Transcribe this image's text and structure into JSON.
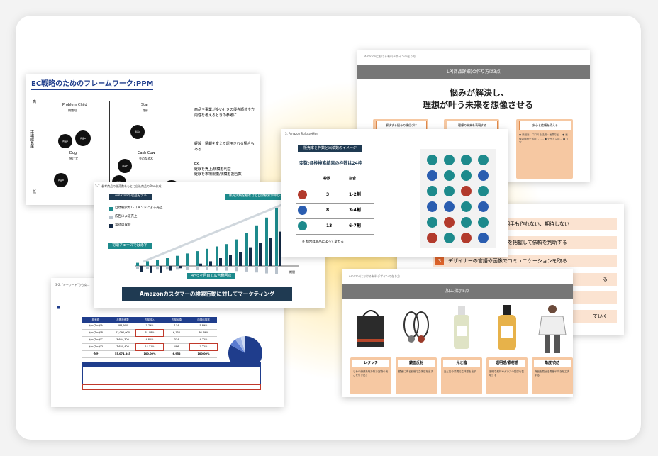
{
  "ppm": {
    "title": "EC戦略のためのフレームワーク:PPM",
    "y_axis_top": "高",
    "y_axis_label": "市場成長率",
    "y_axis_bottom": "低",
    "quadrants": [
      {
        "name": "Problem Child",
        "sub": "問題児"
      },
      {
        "name": "Star",
        "sub": "花形"
      },
      {
        "name": "Dog",
        "sub": "負け犬"
      },
      {
        "name": "Cash Cow",
        "sub": "金のなる木"
      }
    ],
    "bubbles": [
      "商品A",
      "商品B",
      "商品C",
      "商品D",
      "商品E",
      "商品F",
      "商品G",
      "商品H"
    ],
    "note1": "商品や事業が多いときの優先順位や方向性を考えるときの参考に",
    "note2": "経験・情報を変えて運用される場合もある",
    "note3": "Ex.\n経験を売上/規模を利益\n経験を市場規模/規模を割合数"
  },
  "lp": {
    "header": "Amazonにおける有料デザインの在り方",
    "band": "LP(商品詳細)の作り方は3点",
    "title_line1": "悩みが解決し、",
    "title_line2": "理想が叶う未来を想像させる",
    "boxes": [
      "解決する悩みの順位づけ",
      "理想の未来を表現する",
      "安心と信頼を添える"
    ],
    "side_text": "● 商品は、口コミを活用・画像など... ● 画像の詳細を活用して... ● デザインの... ● 文字..."
  },
  "growth": {
    "section": "2-7. 参考商品の販売数をもとに自社商品のPlan作成",
    "legend_title": "Amazonの収益モデル",
    "legend": [
      "自然検索やレコメンドによる売上",
      "広告による売上",
      "累計の収益"
    ],
    "callout_top": "販売実績を積むほど自然検索が伸びる",
    "callout_phase": "初期フェーズでは赤字",
    "callout_ads": "4〜5ヶ月目で広告費回収",
    "x_label": "期間",
    "footer": "Amazonカスタマーの検索行動に対してマーケティング"
  },
  "growth_chart": {
    "type": "bar",
    "series": [
      {
        "name": "自然検索やレコメンドによる売上",
        "values": [
          4,
          6,
          8,
          10,
          13,
          16,
          19,
          22,
          25,
          28,
          34,
          42,
          52,
          62,
          74
        ]
      },
      {
        "name": "広告による売上",
        "values": [
          7,
          7,
          8,
          8,
          8,
          9,
          9,
          9,
          10,
          10,
          11,
          12,
          14,
          16,
          18
        ]
      },
      {
        "name": "累計の収益",
        "values": [
          -8,
          -9,
          -9,
          -6,
          -3,
          0,
          3,
          6,
          10,
          14,
          18,
          24,
          30,
          36,
          44
        ]
      }
    ]
  },
  "keyword": {
    "section": "3-2. \"キーワード\"から商...",
    "tag": "■",
    "headers": [
      "検索語",
      "月間検索数",
      "内部流入",
      "内部転換",
      "内部転換率"
    ],
    "rows": [
      [
        "キーワードA",
        "484,900",
        "7.79%",
        "114",
        "5.89%"
      ],
      [
        "キーワードB",
        "43,090,000",
        "61.08%",
        "6,136",
        "86.79%"
      ],
      [
        "キーワードC",
        "3,604,300",
        "4.81%",
        "334",
        "4.72%"
      ],
      [
        "キーワードD",
        "7,620,400",
        "14.11%",
        "486",
        "7.22%"
      ],
      [
        "合計",
        "55,074,345",
        "100.00%",
        "6,952",
        "100.00%"
      ]
    ]
  },
  "keyword_pie": {
    "type": "pie",
    "values": [
      86.79,
      7.22,
      5.89,
      4.72
    ],
    "colors": [
      "#1f3d8c",
      "#5a7bd0",
      "#9db3e6",
      "#cdd9f2"
    ]
  },
  "prob": {
    "header": "3. Amazon Rufusの傾向",
    "band": "販売率と枠数と出稿数のイメージ",
    "subtitle": "変数:各枠検索結果の枠数は24枠",
    "col1": "枠数",
    "col2": "割合",
    "rows": [
      {
        "count": "3",
        "ratio": "1-2割",
        "color": "#b23a2c"
      },
      {
        "count": "8",
        "ratio": "3-4割",
        "color": "#2a5db0"
      },
      {
        "count": "13",
        "ratio": "6-7割",
        "color": "#1d8a8c"
      }
    ],
    "note": "※ 割合は商品によって変わる",
    "grid": [
      "T",
      "T",
      "T",
      "T",
      "B",
      "T",
      "T",
      "B",
      "T",
      "T",
      "R",
      "T",
      "B",
      "B",
      "T",
      "B",
      "T",
      "R",
      "T",
      "T",
      "R",
      "T",
      "R",
      "B"
    ],
    "palette": {
      "T": "#1d8a8c",
      "B": "#2a5db0",
      "R": "#b23a2c"
    }
  },
  "steps": {
    "items": [
      "相手も作れない、期待しない",
      "を把握して依頼を判断する",
      "デザイナーの言語や画像でコミュニケーションを取る",
      "る",
      "",
      "ていく"
    ],
    "number": "3"
  },
  "products": {
    "header": "Amazonにおける有料デザインの在り方",
    "band": "加工指示5点",
    "labels": [
      "レタッチ",
      "鏡面反射",
      "光と陰",
      "透明感/素材感",
      "角度/向き"
    ],
    "descs": [
      "しわや誇張を取り除き実物の良さを引き出す",
      "鏡面に映る反射で立体感を出す",
      "光と影の表現で立体感を出す",
      "透明な素材やガラスの質感を表現する",
      "商品を見せる角度や向きを工夫する"
    ]
  }
}
